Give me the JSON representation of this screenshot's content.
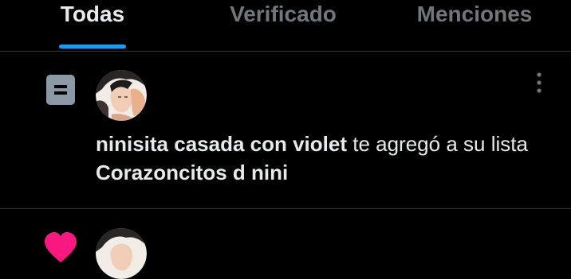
{
  "tabs": [
    {
      "label": "Todas",
      "active": true
    },
    {
      "label": "Verificado",
      "active": false
    },
    {
      "label": "Menciones",
      "active": false
    }
  ],
  "notification": {
    "icon": "list-icon",
    "user_name": "ninisita casada con violet",
    "action_text": "te agregó a su lista",
    "list_name": "Corazoncitos d nini",
    "more_icon": "more-vertical-icon"
  },
  "next_notification": {
    "icon": "heart-icon"
  },
  "colors": {
    "background": "#000000",
    "text_primary": "#e7e9ea",
    "text_secondary": "#71767b",
    "accent": "#1d9bf0",
    "divider": "#2f3336",
    "list_icon": "#8b98a5",
    "heart": "#f91880"
  }
}
